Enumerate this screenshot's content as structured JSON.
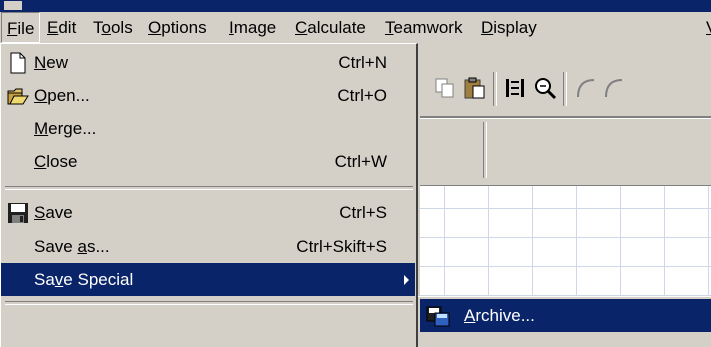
{
  "menubar": {
    "items": [
      {
        "pre": "",
        "key": "F",
        "post": "ile"
      },
      {
        "pre": "",
        "key": "E",
        "post": "dit"
      },
      {
        "pre": "T",
        "key": "o",
        "post": "ols"
      },
      {
        "pre": "",
        "key": "O",
        "post": "ptions"
      },
      {
        "pre": "",
        "key": "I",
        "post": "mage"
      },
      {
        "pre": "",
        "key": "C",
        "post": "alculate"
      },
      {
        "pre": "",
        "key": "T",
        "post": "eamwork"
      },
      {
        "pre": "",
        "key": "D",
        "post": "isplay"
      },
      {
        "pre": "",
        "key": "V",
        "post": ""
      }
    ]
  },
  "file_menu": {
    "items": [
      {
        "pre": "",
        "key": "N",
        "post": "ew",
        "shortcut": "Ctrl+N",
        "icon": "new-file-icon"
      },
      {
        "pre": "",
        "key": "O",
        "post": "pen...",
        "shortcut": "Ctrl+O",
        "icon": "open-folder-icon"
      },
      {
        "pre": "",
        "key": "M",
        "post": "erge...",
        "shortcut": "",
        "icon": ""
      },
      {
        "pre": "",
        "key": "C",
        "post": "lose",
        "shortcut": "Ctrl+W",
        "icon": ""
      },
      {
        "pre": "",
        "key": "S",
        "post": "ave",
        "shortcut": "Ctrl+S",
        "icon": "save-disk-icon"
      },
      {
        "pre": "Save ",
        "key": "a",
        "post": "s...",
        "shortcut": "Ctrl+Skift+S",
        "icon": ""
      },
      {
        "pre": "Sa",
        "key": "v",
        "post": "e Special",
        "shortcut": "",
        "icon": "",
        "highlighted": true,
        "submenu": true
      }
    ]
  },
  "submenu": {
    "items": [
      {
        "pre": "",
        "key": "A",
        "post": "rchive...",
        "icon": "archive-icon",
        "highlighted": true
      }
    ]
  },
  "colors": {
    "highlight": "#0a246a",
    "face": "#d4d0c8"
  }
}
